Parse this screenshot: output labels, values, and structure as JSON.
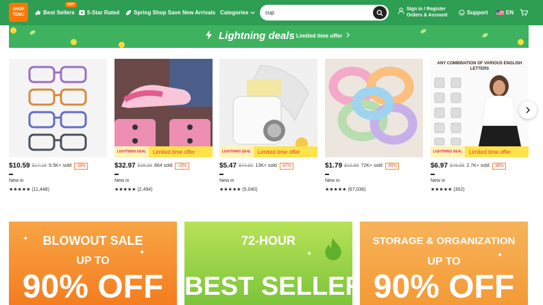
{
  "header": {
    "logo_top": "SHOP",
    "logo_bottom": "TEMU",
    "nav": [
      {
        "label": "Best Sellers",
        "icon": "thumbs-up-icon"
      },
      {
        "label": "5-Star Rated",
        "icon": "star-badge-icon"
      },
      {
        "label": "Spring Shop Save",
        "icon": "leaf-icon"
      },
      {
        "label": "New Arrivals",
        "icon": ""
      },
      {
        "label": "Categories",
        "icon": "chevron-down-icon"
      }
    ],
    "hot_badge": "HOT",
    "search_value": "cup",
    "account_line1": "Sign in / Register",
    "account_line2": "Orders & Account",
    "support": "Support",
    "language": "EN",
    "brand_color": "#2d9e52",
    "logo_color": "#fb7701"
  },
  "banner": {
    "title": "Lightning deals",
    "subtitle": "Limited time offer"
  },
  "products": [
    {
      "price": "$10.59",
      "orig": "$17.16",
      "sold": "9.5K+ sold",
      "discount": "-38%",
      "badge": "",
      "badge_text": "",
      "new": "New in",
      "stars": "★★★★★",
      "reviews": "(11,448)"
    },
    {
      "price": "$32.97",
      "orig": "$38.89",
      "sold": "864 sold",
      "discount": "-15%",
      "badge": "LIGHTNING DEAL",
      "badge_text": "Limited time offer",
      "new": "New in",
      "stars": "★★★★★",
      "reviews": "(2,494)"
    },
    {
      "price": "$5.47",
      "orig": "$44.90",
      "sold": "13K+ sold",
      "discount": "-87%",
      "badge": "LIGHTNING DEAL",
      "badge_text": "Limited time offer",
      "new": "New in",
      "stars": "★★★★★",
      "reviews": "(5,040)"
    },
    {
      "price": "$1.79",
      "orig": "$16.99",
      "sold": "72K+ sold",
      "discount": "-89%",
      "badge": "",
      "badge_text": "",
      "new": "New in",
      "stars": "★★★★★",
      "reviews": "(67,036)"
    },
    {
      "price": "$6.97",
      "orig": "$49.98",
      "sold": "2.7K+ sold",
      "discount": "-86%",
      "badge": "LIGHTNING DEAL",
      "badge_text": "Limited time offer",
      "new": "New in",
      "stars": "★★★★★",
      "reviews": "(302)",
      "image_caption": "ANY COMBINATION OF VARIOUS ENGLISH LETTERS"
    }
  ],
  "promos": [
    {
      "line1": "BLOWOUT SALE",
      "line2": "UP TO",
      "line3": "90% OFF",
      "color": "#f58b2a"
    },
    {
      "line1": "72-HOUR",
      "line2": "BEST SELLERS",
      "line3": "",
      "color": "#8ccf3a"
    },
    {
      "line1": "STORAGE & ORGANIZATION",
      "line2": "UP TO",
      "line3": "90% OFF",
      "color": "#f5a23f"
    }
  ]
}
